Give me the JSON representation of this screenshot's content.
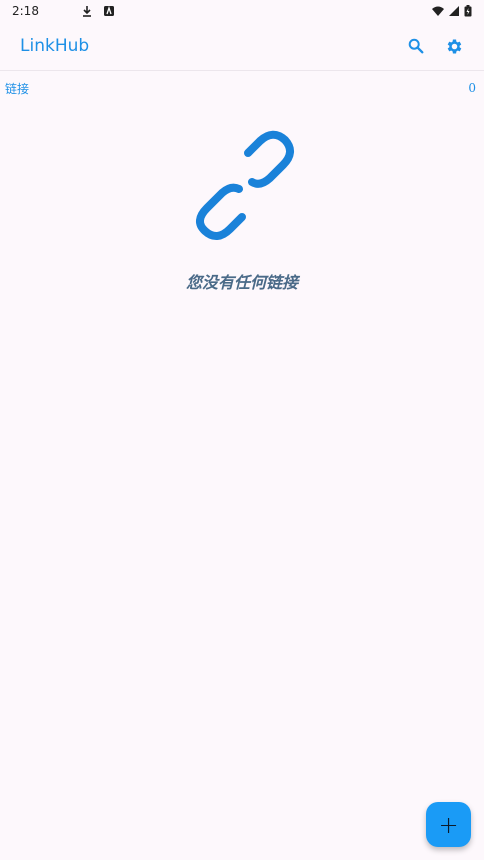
{
  "status_bar": {
    "time": "2:18",
    "icons": [
      "download-icon",
      "a11y-icon",
      "wifi-icon",
      "signal-icon",
      "battery-icon"
    ]
  },
  "app_bar": {
    "title": "LinkHub",
    "actions": [
      "search-icon",
      "gear-icon"
    ]
  },
  "section": {
    "label": "链接",
    "count": "0"
  },
  "empty_state": {
    "icon": "link-icon",
    "message": "您没有任何链接"
  },
  "fab": {
    "icon": "plus-icon",
    "label": "+"
  },
  "colors": {
    "accent": "#1e90e6",
    "background": "#fdf8fc",
    "empty_text": "#4a6a88",
    "fab": "#1a9bf6"
  }
}
